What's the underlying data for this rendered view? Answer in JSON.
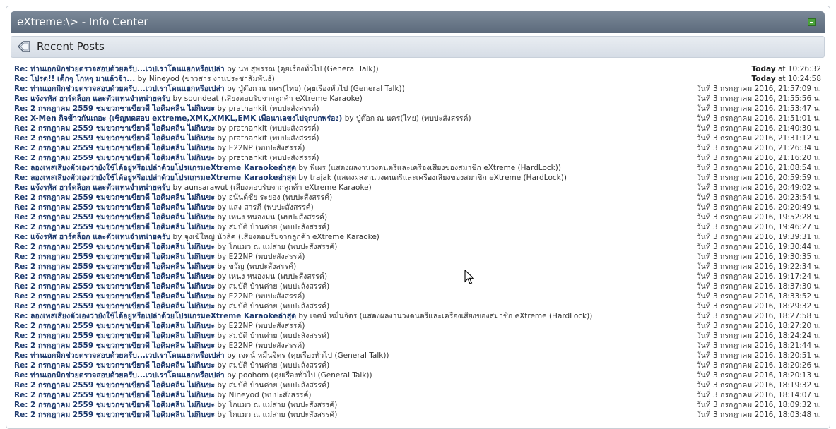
{
  "header": {
    "title": "eXtreme:\\> - Info Center"
  },
  "section": {
    "title": "Recent Posts"
  },
  "posts": [
    {
      "title": "Re: ท่านเอกมิกช่วยตรวจสอบด้วยครับ...เวปเราโดนแฮกหรือเปล่า",
      "by": "by",
      "author": "นพ สุพรรณ",
      "forum": "(คุยเรื่องทั่วไป (General Talk))",
      "date_prefix": "Today",
      "date_rest": "at 10:26:32"
    },
    {
      "title": "Re: โปรด!! เด็กๆ โกหๆ มาแล้วจ้า...",
      "by": "by",
      "author": "Nineyod",
      "forum": "(ข่าวสาร งานประชาสัมพันธ์)",
      "date_prefix": "Today",
      "date_rest": "at 10:24:58"
    },
    {
      "title": "Re: ท่านเอกมิกช่วยตรวจสอบด้วยครับ...เวปเราโดนแฮกหรือเปล่า",
      "by": "by",
      "author": "ปู่ต๊อก ณ นคร(ไทย)",
      "forum": "(คุยเรื่องทั่วไป (General Talk))",
      "date_prefix": "",
      "date_rest": "วันที่ 3 กรกฎาคม 2016, 21:57:09 น."
    },
    {
      "title": "Re: แจ้งรหัส ฮาร์ดล็อก และตัวแทนจำหน่ายครับ",
      "by": "by",
      "author": "soundeat",
      "forum": "(เสียงตอบรับจากลูกค้า eXtreme Karaoke)",
      "date_prefix": "",
      "date_rest": "วันที่ 3 กรกฎาคม 2016, 21:55:56 น."
    },
    {
      "title": "Re: 2 กรกฎาคม 2559 ชมขวกชาเขียวดี ไอคิมคลีน ไม่กินขะ",
      "by": "by",
      "author": "prathankit",
      "forum": "(พบปะสังสรรค์)",
      "date_prefix": "",
      "date_rest": "วันที่ 3 กรกฎาคม 2016, 21:53:47 น."
    },
    {
      "title": "Re: X-Men กิจข้าวกันเถอะ (เชิญทดสอบ extreme,XMK,XMKL,EMK เพื่อนาเลขงไปจุกบกพร่อง)",
      "by": "by",
      "author": "ปู่ต๊อก ณ นคร(ไทย)",
      "forum": "(พบปะสังสรรค์)",
      "date_prefix": "",
      "date_rest": "วันที่ 3 กรกฎาคม 2016, 21:51:01 น."
    },
    {
      "title": "Re: 2 กรกฎาคม 2559 ชมขวกชาเขียวดี ไอคิมคลีน ไม่กินขะ",
      "by": "by",
      "author": "prathankit",
      "forum": "(พบปะสังสรรค์)",
      "date_prefix": "",
      "date_rest": "วันที่ 3 กรกฎาคม 2016, 21:40:30 น."
    },
    {
      "title": "Re: 2 กรกฎาคม 2559 ชมขวกชาเขียวดี ไอคิมคลีน ไม่กินขะ",
      "by": "by",
      "author": "prathankit",
      "forum": "(พบปะสังสรรค์)",
      "date_prefix": "",
      "date_rest": "วันที่ 3 กรกฎาคม 2016, 21:31:12 น."
    },
    {
      "title": "Re: 2 กรกฎาคม 2559 ชมขวกชาเขียวดี ไอคิมคลีน ไม่กินขะ",
      "by": "by",
      "author": "E22NP",
      "forum": "(พบปะสังสรรค์)",
      "date_prefix": "",
      "date_rest": "วันที่ 3 กรกฎาคม 2016, 21:26:34 น."
    },
    {
      "title": "Re: 2 กรกฎาคม 2559 ชมขวกชาเขียวดี ไอคิมคลีน ไม่กินขะ",
      "by": "by",
      "author": "prathankit",
      "forum": "(พบปะสังสรรค์)",
      "date_prefix": "",
      "date_rest": "วันที่ 3 กรกฎาคม 2016, 21:16:20 น."
    },
    {
      "title": "Re: ลองเทสเสียงตัวเองว่ายังใช้ได้อยู่หรือเปล่าด้วยโปรแกรมeXtreme Karaokeล่าสุด",
      "by": "by",
      "author": "พี่เผร",
      "forum": "(แสดงผลงานวงดนตรีและเครื่องเสียงของสมาชิก eXtreme (HardLock))",
      "date_prefix": "",
      "date_rest": "วันที่ 3 กรกฎาคม 2016, 21:08:54 น."
    },
    {
      "title": "Re: ลองเทสเสียงตัวเองว่ายังใช้ได้อยู่หรือเปล่าด้วยโปรแกรมeXtreme Karaokeล่าสุด",
      "by": "by",
      "author": "trajak",
      "forum": "(แสดงผลงานวงดนตรีและเครื่องเสียงของสมาชิก eXtreme (HardLock))",
      "date_prefix": "",
      "date_rest": "วันที่ 3 กรกฎาคม 2016, 20:59:59 น."
    },
    {
      "title": "Re: แจ้งรหัส ฮาร์ดล็อก และตัวแทนจำหน่ายครับ",
      "by": "by",
      "author": "aunsarawut",
      "forum": "(เสียงตอบรับจากลูกค้า eXtreme Karaoke)",
      "date_prefix": "",
      "date_rest": "วันที่ 3 กรกฎาคม 2016, 20:49:02 น."
    },
    {
      "title": "Re: 2 กรกฎาคม 2559 ชมขวกชาเขียวดี ไอคิมคลีน ไม่กินขะ",
      "by": "by",
      "author": "อนันต์ชัย ระยอง",
      "forum": "(พบปะสังสรรค์)",
      "date_prefix": "",
      "date_rest": "วันที่ 3 กรกฎาคม 2016, 20:23:54 น."
    },
    {
      "title": "Re: 2 กรกฎาคม 2559 ชมขวกชาเขียวดี ไอคิมคลีน ไม่กินขะ",
      "by": "by",
      "author": "แสง สารภี",
      "forum": "(พบปะสังสรรค์)",
      "date_prefix": "",
      "date_rest": "วันที่ 3 กรกฎาคม 2016, 20:20:49 น."
    },
    {
      "title": "Re: 2 กรกฎาคม 2559 ชมขวกชาเขียวดี ไอคิมคลีน ไม่กินขะ",
      "by": "by",
      "author": "เหน่ง หนองมน",
      "forum": "(พบปะสังสรรค์)",
      "date_prefix": "",
      "date_rest": "วันที่ 3 กรกฎาคม 2016, 19:52:28 น."
    },
    {
      "title": "Re: 2 กรกฎาคม 2559 ชมขวกชาเขียวดี ไอคิมคลีน ไม่กินขะ",
      "by": "by",
      "author": "สมบัติ บ้านค่าย",
      "forum": "(พบปะสังสรรค์)",
      "date_prefix": "",
      "date_rest": "วันที่ 3 กรกฎาคม 2016, 19:46:27 น."
    },
    {
      "title": "Re: แจ้งรหัส ฮาร์ดล็อก และตัวแทนจำหน่ายครับ",
      "by": "by",
      "author": "จุงเข้ใหญ่ นัวลิค",
      "forum": "(เสียงตอบรับจากลูกค้า eXtreme Karaoke)",
      "date_prefix": "",
      "date_rest": "วันที่ 3 กรกฎาคม 2016, 19:39:31 น."
    },
    {
      "title": "Re: 2 กรกฎาคม 2559 ชมขวกชาเขียวดี ไอคิมคลีน ไม่กินขะ",
      "by": "by",
      "author": "โกแมว ณ แม่สาย",
      "forum": "(พบปะสังสรรค์)",
      "date_prefix": "",
      "date_rest": "วันที่ 3 กรกฎาคม 2016, 19:30:44 น."
    },
    {
      "title": "Re: 2 กรกฎาคม 2559 ชมขวกชาเขียวดี ไอคิมคลีน ไม่กินขะ",
      "by": "by",
      "author": "E22NP",
      "forum": "(พบปะสังสรรค์)",
      "date_prefix": "",
      "date_rest": "วันที่ 3 กรกฎาคม 2016, 19:30:35 น."
    },
    {
      "title": "Re: 2 กรกฎาคม 2559 ชมขวกชาเขียวดี ไอคิมคลีน ไม่กินขะ",
      "by": "by",
      "author": "ขวัญ",
      "forum": "(พบปะสังสรรค์)",
      "date_prefix": "",
      "date_rest": "วันที่ 3 กรกฎาคม 2016, 19:22:34 น."
    },
    {
      "title": "Re: 2 กรกฎาคม 2559 ชมขวกชาเขียวดี ไอคิมคลีน ไม่กินขะ",
      "by": "by",
      "author": "เหน่ง หนองมน",
      "forum": "(พบปะสังสรรค์)",
      "date_prefix": "",
      "date_rest": "วันที่ 3 กรกฎาคม 2016, 19:17:24 น."
    },
    {
      "title": "Re: 2 กรกฎาคม 2559 ชมขวกชาเขียวดี ไอคิมคลีน ไม่กินขะ",
      "by": "by",
      "author": "สมบัติ บ้านค่าย",
      "forum": "(พบปะสังสรรค์)",
      "date_prefix": "",
      "date_rest": "วันที่ 3 กรกฎาคม 2016, 18:37:30 น."
    },
    {
      "title": "Re: 2 กรกฎาคม 2559 ชมขวกชาเขียวดี ไอคิมคลีน ไม่กินขะ",
      "by": "by",
      "author": "E22NP",
      "forum": "(พบปะสังสรรค์)",
      "date_prefix": "",
      "date_rest": "วันที่ 3 กรกฎาคม 2016, 18:33:52 น."
    },
    {
      "title": "Re: 2 กรกฎาคม 2559 ชมขวกชาเขียวดี ไอคิมคลีน ไม่กินขะ",
      "by": "by",
      "author": "สมบัติ บ้านค่าย",
      "forum": "(พบปะสังสรรค์)",
      "date_prefix": "",
      "date_rest": "วันที่ 3 กรกฎาคม 2016, 18:29:32 น."
    },
    {
      "title": "Re: ลองเทสเสียงตัวเองว่ายังใช้ได้อยู่หรือเปล่าด้วยโปรแกรมeXtreme Karaokeล่าสุด",
      "by": "by",
      "author": "เจตน์ หมื่นจิตร",
      "forum": "(แสดงผลงานวงดนตรีและเครื่องเสียงของสมาชิก eXtreme (HardLock))",
      "date_prefix": "",
      "date_rest": "วันที่ 3 กรกฎาคม 2016, 18:27:58 น."
    },
    {
      "title": "Re: 2 กรกฎาคม 2559 ชมขวกชาเขียวดี ไอคิมคลีน ไม่กินขะ",
      "by": "by",
      "author": "E22NP",
      "forum": "(พบปะสังสรรค์)",
      "date_prefix": "",
      "date_rest": "วันที่ 3 กรกฎาคม 2016, 18:27:20 น."
    },
    {
      "title": "Re: 2 กรกฎาคม 2559 ชมขวกชาเขียวดี ไอคิมคลีน ไม่กินขะ",
      "by": "by",
      "author": "สมบัติ บ้านค่าย",
      "forum": "(พบปะสังสรรค์)",
      "date_prefix": "",
      "date_rest": "วันที่ 3 กรกฎาคม 2016, 18:24:24 น."
    },
    {
      "title": "Re: 2 กรกฎาคม 2559 ชมขวกชาเขียวดี ไอคิมคลีน ไม่กินขะ",
      "by": "by",
      "author": "E22NP",
      "forum": "(พบปะสังสรรค์)",
      "date_prefix": "",
      "date_rest": "วันที่ 3 กรกฎาคม 2016, 18:21:44 น."
    },
    {
      "title": "Re: ท่านเอกมิกช่วยตรวจสอบด้วยครับ...เวปเราโดนแฮกหรือเปล่า",
      "by": "by",
      "author": "เจตน์ หมื่นจิตร",
      "forum": "(คุยเรื่องทั่วไป (General Talk))",
      "date_prefix": "",
      "date_rest": "วันที่ 3 กรกฎาคม 2016, 18:20:51 น."
    },
    {
      "title": "Re: 2 กรกฎาคม 2559 ชมขวกชาเขียวดี ไอคิมคลีน ไม่กินขะ",
      "by": "by",
      "author": "สมบัติ บ้านค่าย",
      "forum": "(พบปะสังสรรค์)",
      "date_prefix": "",
      "date_rest": "วันที่ 3 กรกฎาคม 2016, 18:20:26 น."
    },
    {
      "title": "Re: ท่านเอกมิกช่วยตรวจสอบด้วยครับ...เวปเราโดนแฮกหรือเปล่า",
      "by": "by",
      "author": "poohom",
      "forum": "(คุยเรื่องทั่วไป (General Talk))",
      "date_prefix": "",
      "date_rest": "วันที่ 3 กรกฎาคม 2016, 18:20:13 น."
    },
    {
      "title": "Re: 2 กรกฎาคม 2559 ชมขวกชาเขียวดี ไอคิมคลีน ไม่กินขะ",
      "by": "by",
      "author": "สมบัติ บ้านค่าย",
      "forum": "(พบปะสังสรรค์)",
      "date_prefix": "",
      "date_rest": "วันที่ 3 กรกฎาคม 2016, 18:19:32 น."
    },
    {
      "title": "Re: 2 กรกฎาคม 2559 ชมขวกชาเขียวดี ไอคิมคลีน ไม่กินขะ",
      "by": "by",
      "author": "Nineyod",
      "forum": "(พบปะสังสรรค์)",
      "date_prefix": "",
      "date_rest": "วันที่ 3 กรกฎาคม 2016, 18:14:07 น."
    },
    {
      "title": "Re: 2 กรกฎาคม 2559 ชมขวกชาเขียวดี ไอคิมคลีน ไม่กินขะ",
      "by": "by",
      "author": "โกแมว ณ แม่สาย",
      "forum": "(พบปะสังสรรค์)",
      "date_prefix": "",
      "date_rest": "วันที่ 3 กรกฎาคม 2016, 18:09:32 น."
    },
    {
      "title": "Re: 2 กรกฎาคม 2559 ชมขวกชาเขียวดี ไอคิมคลีน ไม่กินขะ",
      "by": "by",
      "author": "โกแมว ณ แม่สาย",
      "forum": "(พบปะสังสรรค์)",
      "date_prefix": "",
      "date_rest": "วันที่ 3 กรกฎาคม 2016, 18:03:48 น."
    }
  ]
}
